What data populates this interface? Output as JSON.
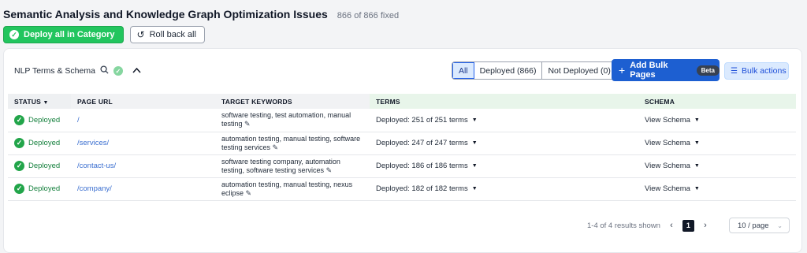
{
  "header": {
    "title": "Semantic Analysis and Knowledge Graph Optimization Issues",
    "fixed_count": "866 of 866 fixed",
    "deploy_all_label": "Deploy all in Category",
    "rollback_label": "Roll back all"
  },
  "toolbar": {
    "category_label": "NLP Terms & Schema",
    "filter_all": "All",
    "filter_deployed": "Deployed (866)",
    "filter_not_deployed": "Not Deployed (0)",
    "add_bulk_label": "Add Bulk Pages",
    "beta_badge": "Beta",
    "bulk_actions_label": "Bulk actions"
  },
  "table": {
    "headers": {
      "status": "STATUS",
      "page_url": "PAGE URL",
      "target_keywords": "TARGET KEYWORDS",
      "terms": "TERMS",
      "schema": "SCHEMA"
    },
    "rows": [
      {
        "status": "Deployed",
        "url": "/",
        "keywords": "software testing, test automation, manual testing",
        "terms": "Deployed: 251 of 251 terms",
        "schema": "View Schema"
      },
      {
        "status": "Deployed",
        "url": "/services/",
        "keywords": "automation testing, manual testing, software testing services",
        "terms": "Deployed: 247 of 247 terms",
        "schema": "View Schema"
      },
      {
        "status": "Deployed",
        "url": "/contact-us/",
        "keywords": "software testing company, automation testing, software testing services",
        "terms": "Deployed: 186 of 186 terms",
        "schema": "View Schema"
      },
      {
        "status": "Deployed",
        "url": "/company/",
        "keywords": "automation testing, manual testing, nexus eclipse",
        "terms": "Deployed: 182 of 182 terms",
        "schema": "View Schema"
      }
    ]
  },
  "pagination": {
    "summary": "1-4 of 4 results shown",
    "current_page": "1",
    "per_page": "10 / page"
  },
  "colors": {
    "accent_green": "#22c55e",
    "primary_blue": "#1d5fd1"
  }
}
